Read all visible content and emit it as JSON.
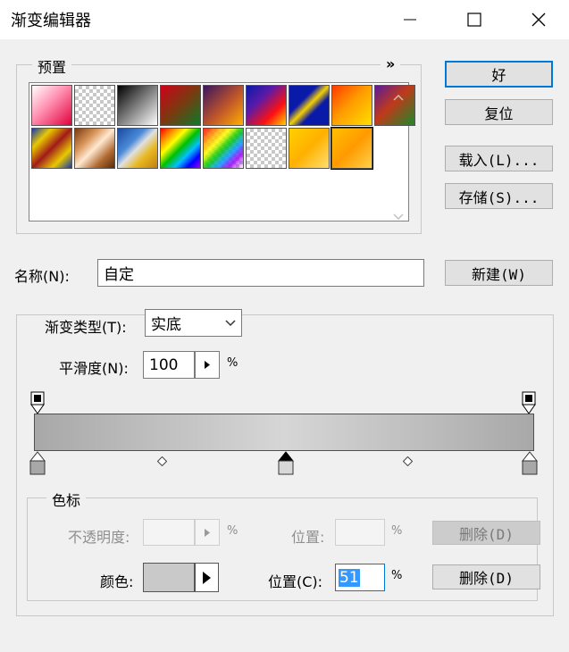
{
  "window": {
    "title": "渐变编辑器"
  },
  "presets": {
    "legend": "预置",
    "more_glyph": "»",
    "swatches": [
      {
        "css": "linear-gradient(135deg,#ffffff 0%,#ff8fb0 45%,#e0003c 100%)"
      },
      {
        "css": "checker-white"
      },
      {
        "css": "linear-gradient(135deg,#000000 0%,#808080 50%,#ffffff 100%)"
      },
      {
        "css": "linear-gradient(135deg,#d0001a 0%,#7a3a10 50%,#0b7a2a 100%)"
      },
      {
        "css": "linear-gradient(135deg,#3a1560 0%,#c0562a 55%,#ffb000 100%)"
      },
      {
        "css": "linear-gradient(135deg,#0a1aa8 0%,#5a1aa8 35%,#ff1010 70%,#ffd400 100%)"
      },
      {
        "css": "linear-gradient(135deg,#0a1aa8 0%,#0a1aa8 35%,#f5d000 50%,#0a1aa8 65%,#0a1aa8 100%)"
      },
      {
        "css": "linear-gradient(135deg,#ff3a00 0%,#ff9a00 45%,#ffe000 100%)"
      },
      {
        "css": "linear-gradient(135deg,#5a1a9a 0%,#c03a1a 45%,#1a8a2a 100%)"
      },
      {
        "css": "linear-gradient(135deg,#1a3aa8 0%,#e8c800 25%,#a01a1a 50%,#e8c800 75%,#1a3aa8 100%)"
      },
      {
        "css": "linear-gradient(135deg,#7a3a10 0%,#d8955a 30%,#ffe8d0 50%,#b06a30 75%,#5a2a0a 100%)"
      },
      {
        "css": "linear-gradient(135deg,#1a4aa0 0%,#4a8ad8 35%,#e0e0e0 50%,#e8b820 70%,#c08010 100%)"
      },
      {
        "css": "linear-gradient(135deg,#ff0000 0%,#ff8800 17%,#ffff00 33%,#00c000 50%,#00c0ff 67%,#0000ff 83%,#a000ff 100%)"
      },
      {
        "css": "checker-rainbow"
      },
      {
        "css": "checker-white"
      },
      {
        "css": "linear-gradient(135deg,#ffd000 0%,#ffb000 50%,#ffe070 100%)"
      },
      {
        "css": "linear-gradient(135deg,#ffc000 0%,#ff9a00 50%,#ffd24a 100%)"
      }
    ],
    "selected_index": 16
  },
  "buttons": {
    "ok": "好",
    "reset": "复位",
    "load": "载入(L)...",
    "save": "存储(S)...",
    "new": "新建(W)",
    "delete_opacity": "删除(D)",
    "delete_color": "删除(D)"
  },
  "name": {
    "label": "名称(N):",
    "value": "自定"
  },
  "gradient": {
    "type_label": "渐变类型(T):",
    "type_value": "实底",
    "smooth_label": "平滑度(N):",
    "smooth_value": "100",
    "smooth_unit": "%",
    "stops_legend": "色标",
    "opacity_label": "不透明度:",
    "opacity_unit": "%",
    "location_label_disabled": "位置:",
    "location_unit_disabled": "%",
    "color_label": "颜色:",
    "color_value": "#c9c9c9",
    "location_label": "位置(C):",
    "location_value": "51",
    "location_unit": "%"
  }
}
